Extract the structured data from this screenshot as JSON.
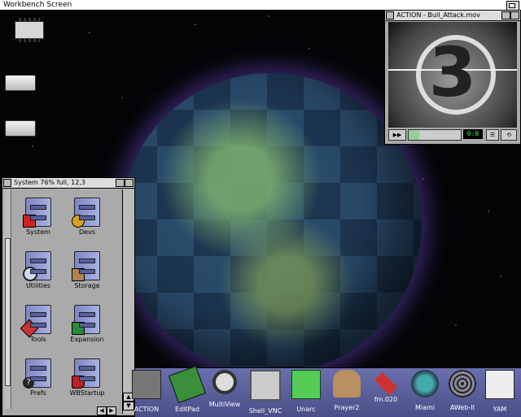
{
  "screen": {
    "title": "Workbench Screen"
  },
  "desktop_icons": [
    "ram-disk-chip-icon",
    "floppy-drive-icon",
    "hard-drive-icon"
  ],
  "drawer": {
    "title": "System  76% full, 12,3",
    "icons": [
      {
        "label": "System",
        "badge": "red-block-icon"
      },
      {
        "label": "Devs",
        "badge": "gears-icon"
      },
      {
        "label": "Utilities",
        "badge": "magnifier-icon"
      },
      {
        "label": "Storage",
        "badge": "box-icon"
      },
      {
        "label": "Tools",
        "badge": "wrench-icon"
      },
      {
        "label": "Expansion",
        "badge": "circuit-board-icon"
      },
      {
        "label": "Prefs",
        "badge": "question-mark-icon"
      },
      {
        "label": "WBStartup",
        "badge": "boot-icon"
      }
    ]
  },
  "player": {
    "title": "ACTION - Bull_Attack.mov",
    "frame_number": "3",
    "timecode": "0:0"
  },
  "dock": {
    "items": [
      {
        "label": "ACTION",
        "icon": "action-player-icon"
      },
      {
        "label": "EditPad",
        "icon": "notepad-pencil-icon"
      },
      {
        "label": "MultiView",
        "icon": "magnifier-icon"
      },
      {
        "label": "Shell_VNC",
        "icon": "shell-window-icon"
      },
      {
        "label": "Unarc",
        "icon": "green-cube-icon"
      },
      {
        "label": "Prayer2",
        "icon": "sphinx-icon"
      },
      {
        "label": "fm.020",
        "icon": "red-tool-icon"
      },
      {
        "label": "Miami",
        "icon": "globe-network-icon"
      },
      {
        "label": "AWeb-II",
        "icon": "web-icon"
      },
      {
        "label": "YAM",
        "icon": "mailbox-icon"
      }
    ]
  },
  "colors": {
    "desktop": "#050508",
    "dock": "#5a60a0",
    "window": "#aaaaaa",
    "timecode": "#33ff33"
  }
}
